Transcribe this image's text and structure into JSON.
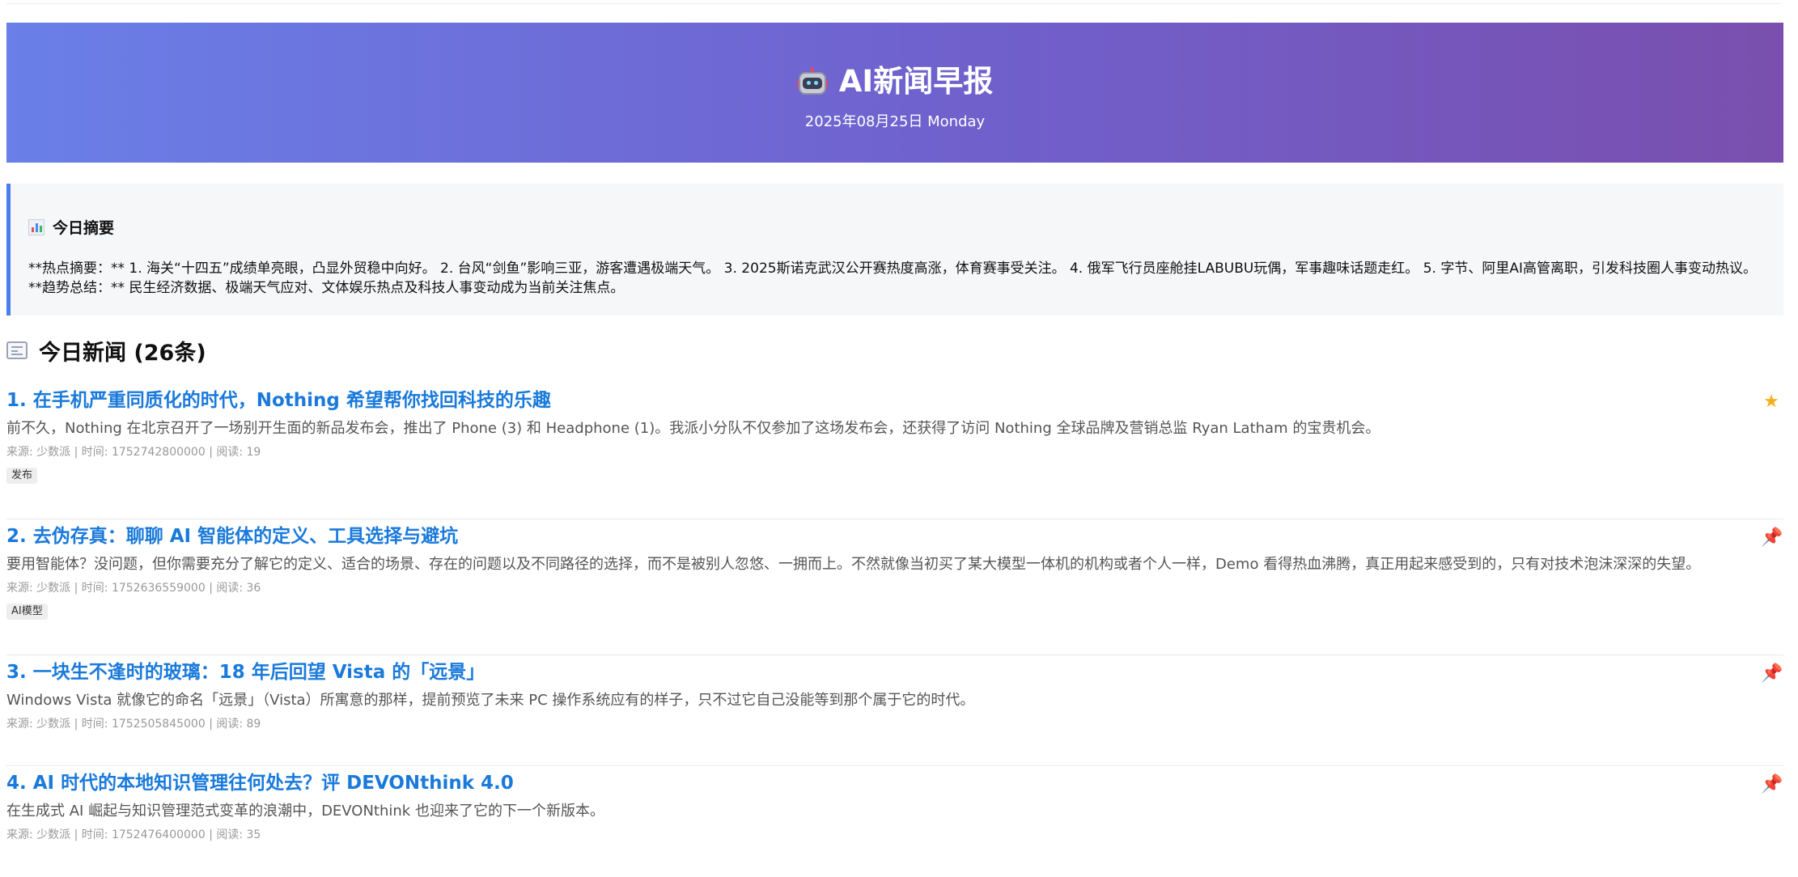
{
  "header": {
    "title": "AI新闻早报",
    "date": "2025年08月25日 Monday",
    "icon": "robot-icon"
  },
  "summary": {
    "heading": "今日摘要",
    "icon": "bar-chart-icon",
    "text": "**热点摘要：** 1. 海关“十四五”成绩单亮眼，凸显外贸稳中向好。 2. 台风“剑鱼”影响三亚，游客遭遇极端天气。 3. 2025斯诺克武汉公开赛热度高涨，体育赛事受关注。 4. 俄军飞行员座舱挂LABUBU玩偶，军事趣味话题走红。 5. 字节、阿里AI高管离职，引发科技圈人事变动热议。 **趋势总结：** 民生经济数据、极端天气应对、文体娱乐热点及科技人事变动成为当前关注焦点。"
  },
  "news": {
    "heading": "今日新闻 (26条)",
    "icon": "newspaper-icon",
    "items": [
      {
        "title": "1. 在手机严重同质化的时代，Nothing 希望帮你找回科技的乐趣",
        "desc": "前不久，Nothing 在北京召开了一场别开生面的新品发布会，推出了 Phone (3) 和 Headphone (1)。我派小分队不仅参加了这场发布会，还获得了访问 Nothing 全球品牌及营销总监 Ryan Latham 的宝贵机会。",
        "meta": "来源: 少数派 | 时间: 1752742800000 | 阅读: 19",
        "tag": "发布",
        "mark": "star-icon"
      },
      {
        "title": "2. 去伪存真：聊聊 AI 智能体的定义、工具选择与避坑",
        "desc": "要用智能体？没问题，但你需要充分了解它的定义、适合的场景、存在的问题以及不同路径的选择，而不是被别人忽悠、一拥而上。不然就像当初买了某大模型一体机的机构或者个人一样，Demo 看得热血沸腾，真正用起来感受到的，只有对技术泡沫深深的失望。",
        "meta": "来源: 少数派 | 时间: 1752636559000 | 阅读: 36",
        "tag": "AI模型",
        "mark": "pin-icon"
      },
      {
        "title": "3. 一块生不逢时的玻璃：18 年后回望 Vista 的「远景」",
        "desc": "Windows Vista 就像它的命名「远景」（Vista）所寓意的那样，提前预览了未来 PC 操作系统应有的样子，只不过它自己没能等到那个属于它的时代。",
        "meta": "来源: 少数派 | 时间: 1752505845000 | 阅读: 89",
        "tag": "",
        "mark": "pin-icon"
      },
      {
        "title": "4. AI 时代的本地知识管理往何处去？评 DEVONthink 4.0",
        "desc": "在生成式 AI 崛起与知识管理范式变革的浪潮中，DEVONthink 也迎来了它的下一个新版本。",
        "meta": "来源: 少数派 | 时间: 1752476400000 | 阅读: 35",
        "tag": "",
        "mark": "pin-icon"
      }
    ]
  }
}
